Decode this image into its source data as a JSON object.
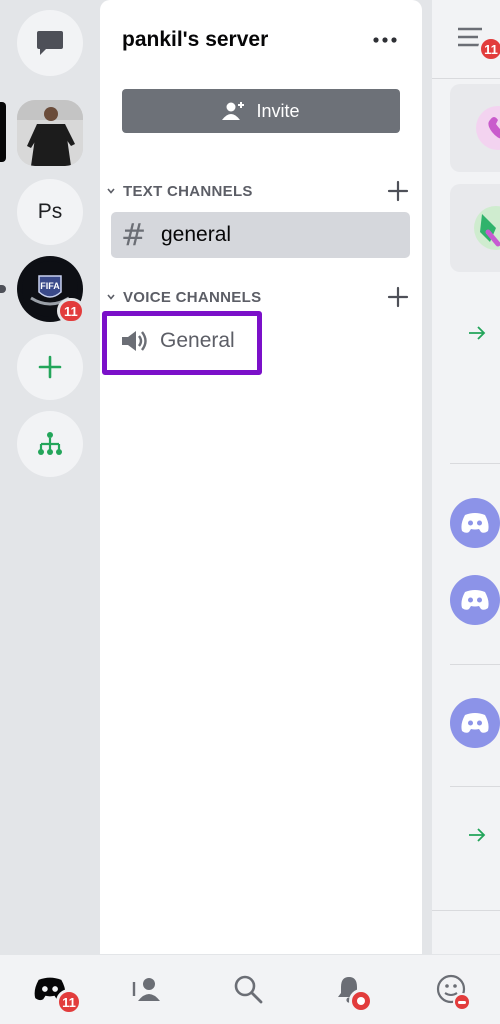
{
  "server": {
    "name": "pankil's server",
    "invite_label": "Invite"
  },
  "rail": {
    "servers": [
      {
        "name": "messages-icon"
      },
      {
        "name": "photo-server"
      },
      {
        "name": "Ps",
        "label": "Ps"
      },
      {
        "name": "FIFA",
        "label": "FIFA",
        "badge": "11"
      },
      {
        "name": "add-server-icon"
      },
      {
        "name": "explore-icon"
      }
    ]
  },
  "categories": {
    "text": "TEXT CHANNELS",
    "voice": "VOICE CHANNELS"
  },
  "channels": {
    "text": [
      {
        "label": "general",
        "selected": true
      }
    ],
    "voice": [
      {
        "label": "General",
        "highlighted": true
      }
    ]
  },
  "peek": {
    "menu_badge": "11"
  },
  "bottom_nav": {
    "home_badge": "11",
    "items": [
      "home",
      "friends",
      "search",
      "notifications",
      "you"
    ]
  },
  "colors": {
    "accent_badge": "#e23c3c",
    "highlight_outline": "#7b10c9",
    "discord_blurple": "#8c93e8",
    "green": "#23a55a"
  }
}
